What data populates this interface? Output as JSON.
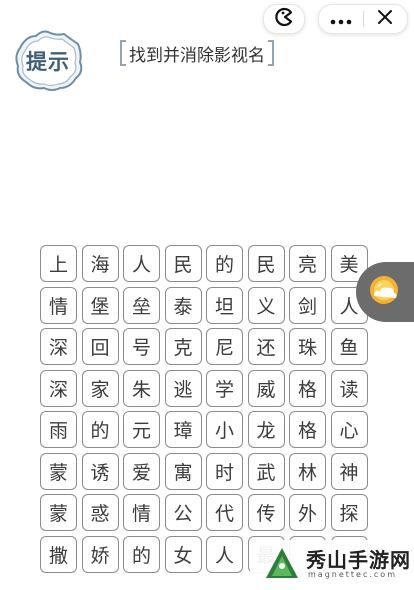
{
  "hint": {
    "label": "提示"
  },
  "task": {
    "title": "找到并消除影视名"
  },
  "grid": {
    "rows": [
      [
        "上",
        "海",
        "人",
        "民",
        "的",
        "民",
        "亮",
        "美"
      ],
      [
        "情",
        "堡",
        "垒",
        "泰",
        "坦",
        "义",
        "剑",
        "人"
      ],
      [
        "深",
        "回",
        "号",
        "克",
        "尼",
        "还",
        "珠",
        "鱼"
      ],
      [
        "深",
        "家",
        "朱",
        "逃",
        "学",
        "威",
        "格",
        "读"
      ],
      [
        "雨",
        "的",
        "元",
        "璋",
        "小",
        "龙",
        "格",
        "心"
      ],
      [
        "蒙",
        "诱",
        "爱",
        "寓",
        "时",
        "武",
        "林",
        "神"
      ],
      [
        "蒙",
        "惑",
        "情",
        "公",
        "代",
        "传",
        "外",
        "探"
      ],
      [
        "撒",
        "娇",
        "的",
        "女",
        "人",
        "最",
        "",
        ""
      ]
    ]
  },
  "icons": {
    "menu": "more-dots-icon",
    "close": "close-icon",
    "pac": "pacman-icon",
    "float": "sun-cloud-icon"
  },
  "watermark": {
    "title": "秀山手游网",
    "subtitle": "magnettec.com"
  },
  "colors": {
    "cell_border": "#8c8c8c",
    "hint_text": "#3f5f74",
    "bracket": "#93a4b3"
  }
}
